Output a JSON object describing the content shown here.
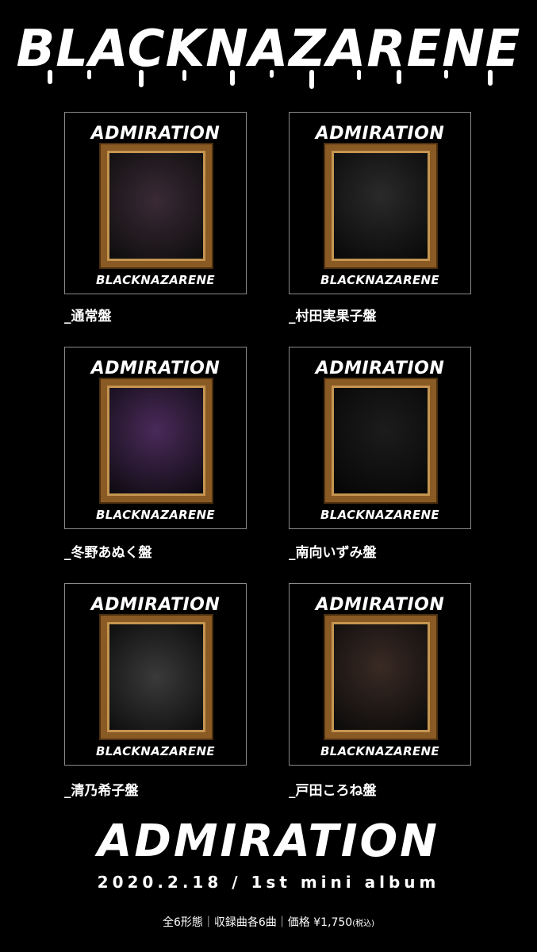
{
  "header": {
    "band_name": "BLACKNAZARENE"
  },
  "editions": [
    {
      "cover_title": "ADMIRATION",
      "cover_band": "BLACKNAZARENE",
      "label": "_通常盤",
      "photo_colors": [
        "#3a2a36",
        "#0d0d0d"
      ],
      "photo_icon": "group-photo-icon"
    },
    {
      "cover_title": "ADMIRATION",
      "cover_band": "BLACKNAZARENE",
      "label": "_村田実果子盤",
      "photo_colors": [
        "#2a2a2a",
        "#080808"
      ],
      "photo_icon": "portrait-photo-icon"
    },
    {
      "cover_title": "ADMIRATION",
      "cover_band": "BLACKNAZARENE",
      "label": "_冬野あぬく盤",
      "photo_colors": [
        "#4a2a5a",
        "#0d0a10"
      ],
      "photo_icon": "portrait-photo-icon"
    },
    {
      "cover_title": "ADMIRATION",
      "cover_band": "BLACKNAZARENE",
      "label": "_南向いずみ盤",
      "photo_colors": [
        "#1c1c1c",
        "#050505"
      ],
      "photo_icon": "portrait-photo-icon"
    },
    {
      "cover_title": "ADMIRATION",
      "cover_band": "BLACKNAZARENE",
      "label": "_清乃希子盤",
      "photo_colors": [
        "#3a3a3a",
        "#0e0e0e"
      ],
      "photo_icon": "portrait-photo-icon"
    },
    {
      "cover_title": "ADMIRATION",
      "cover_band": "BLACKNAZARENE",
      "label": "_戸田ころね盤",
      "photo_colors": [
        "#3a2a24",
        "#0a0a0a"
      ],
      "photo_icon": "portrait-photo-icon"
    }
  ],
  "footer": {
    "album_title": "ADMIRATION",
    "release": "2020.2.18 / 1st mini album",
    "info_main": "全6形態｜収録曲各6曲｜価格 ¥1,750",
    "info_tax": "(税込)"
  },
  "colors": {
    "background": "#000000",
    "frame_gold": "#8a5a24",
    "text": "#ffffff"
  }
}
